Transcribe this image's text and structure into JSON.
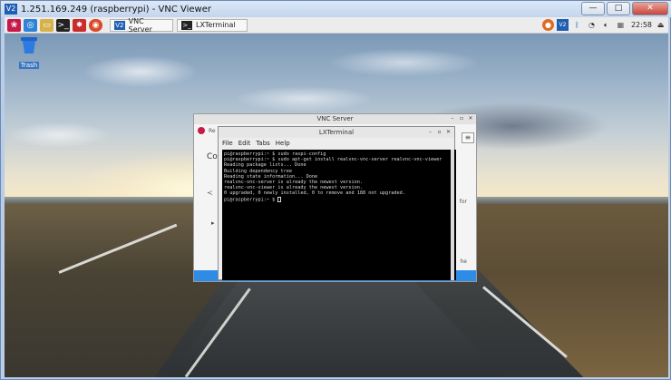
{
  "viewer": {
    "logo": "V2",
    "title": "1.251.169.249 (raspberrypi) - VNC Viewer",
    "controls": [
      "—",
      "□",
      "✕"
    ]
  },
  "panel": {
    "launchers": [
      "raspberry-menu-icon",
      "browser-icon",
      "file-manager-icon",
      "terminal-icon",
      "mathematica-icon",
      "wolfram-icon"
    ],
    "tasks": [
      {
        "icon": "V2",
        "label": "VNC Server"
      },
      {
        "icon": ">_",
        "label": "LXTerminal"
      }
    ],
    "tray": {
      "clock": "22:58"
    }
  },
  "desktop": {
    "trash_label": "Trash"
  },
  "vnc_server_window": {
    "title": "VNC Server",
    "ra_text": "Re",
    "heading": "Co",
    "right_text_1": "for",
    "right_text_2": "he"
  },
  "terminal": {
    "title": "LXTerminal",
    "menu": [
      "File",
      "Edit",
      "Tabs",
      "Help"
    ],
    "lines": [
      "pi@raspberrypi:~ $ sudo raspi-config",
      "pi@raspberrypi:~ $ sudo apt-get install realvnc-vnc-server realvnc-vnc-viewer",
      "Reading package lists... Done",
      "Building dependency tree",
      "Reading state information... Done",
      "realvnc-vnc-server is already the newest version.",
      "realvnc-vnc-viewer is already the newest version.",
      "0 upgraded, 0 newly installed, 0 to remove and 188 not upgraded.",
      "pi@raspberrypi:~ $ "
    ]
  }
}
